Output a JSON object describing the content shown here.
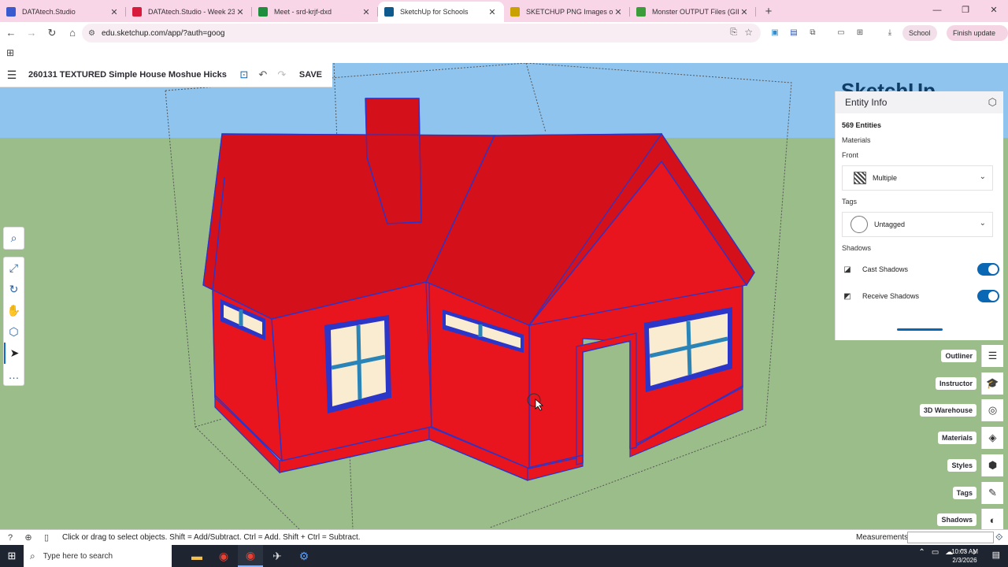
{
  "browser": {
    "tabs": [
      {
        "title": "DATAtech.Studio",
        "color": "#3a5ad0",
        "active": false
      },
      {
        "title": "DATAtech.Studio - Week 23",
        "color": "#d81b3c",
        "active": false
      },
      {
        "title": "Meet - srd-krjf-dxd",
        "color": "#1e8e3e",
        "active": false
      },
      {
        "title": "SketchUp for Schools",
        "color": "#0f5a8c",
        "active": true
      },
      {
        "title": "SKETCHUP PNG Images of Pain",
        "color": "#c9a100",
        "active": false
      },
      {
        "title": "Monster OUTPUT Files (GIF and",
        "color": "#3a9d3a",
        "active": false
      }
    ],
    "url": "edu.sketchup.com/app/?auth=goog",
    "profile_label": "School",
    "update_label": "Finish update"
  },
  "sketchup": {
    "model_title": "260131 TEXTURED Simple House Moshue Hicks",
    "save_label": "SAVE",
    "logo_text": "SketchUp",
    "tools": [
      {
        "name": "search-tool",
        "icon": "search-icon",
        "glyph": "⌕"
      },
      {
        "name": "zoom-extents-tool",
        "icon": "zoom-icon",
        "glyph": "⤢"
      },
      {
        "name": "orbit-tool",
        "icon": "orbit-icon",
        "glyph": "↻"
      },
      {
        "name": "pan-tool",
        "icon": "pan-icon",
        "glyph": "✋"
      },
      {
        "name": "walk-tool",
        "icon": "walk-icon",
        "glyph": "⬡"
      },
      {
        "name": "select-tool",
        "icon": "cursor-icon",
        "glyph": "➤"
      },
      {
        "name": "more-tools",
        "icon": "more-icon",
        "glyph": "…"
      }
    ]
  },
  "entity_info": {
    "title": "Entity Info",
    "count": "569 Entities",
    "materials_label": "Materials",
    "front_label": "Front",
    "front_value": "Multiple",
    "tags_label": "Tags",
    "tags_value": "Untagged",
    "shadows_label": "Shadows",
    "cast_shadows": "Cast Shadows",
    "receive_shadows": "Receive Shadows",
    "cast_on": true,
    "receive_on": true
  },
  "tray": [
    {
      "label": "Outliner",
      "icon": "outliner-icon",
      "glyph": "☰"
    },
    {
      "label": "Instructor",
      "icon": "instructor-icon",
      "glyph": "🎓"
    },
    {
      "label": "3D Warehouse",
      "icon": "warehouse-icon",
      "glyph": "◎"
    },
    {
      "label": "Materials",
      "icon": "materials-icon",
      "glyph": "◈"
    },
    {
      "label": "Styles",
      "icon": "styles-icon",
      "glyph": "⬢"
    },
    {
      "label": "Tags",
      "icon": "tags-icon",
      "glyph": "✎"
    },
    {
      "label": "Shadows",
      "icon": "shadows-icon",
      "glyph": "◐"
    }
  ],
  "status": {
    "hint": "Click or drag to select objects. Shift = Add/Subtract. Ctrl = Add. Shift + Ctrl = Subtract.",
    "measurements_label": "Measurements",
    "measurements_value": ""
  },
  "taskbar": {
    "search_placeholder": "Type here to search",
    "time": "10:03 AM",
    "date": "2/3/2026"
  },
  "colors": {
    "sky": "#8fc4ef",
    "ground": "#9bbd8a",
    "house_wall": "#e8141e",
    "house_roof": "#d4101a",
    "edge": "#2b35c8",
    "glass": "#f9ecd0",
    "window_frame": "#2a84b8"
  }
}
